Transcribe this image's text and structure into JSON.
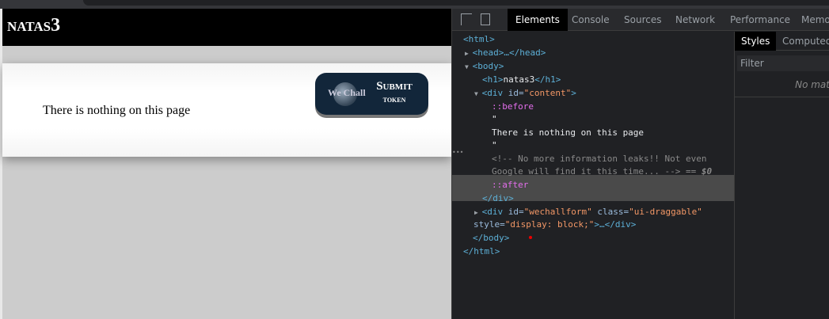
{
  "page": {
    "heading": "natas3",
    "content_text": "There is nothing on this page",
    "wechall": {
      "logo_text": "We Chall",
      "submit": "Submit",
      "token": "token"
    }
  },
  "devtools": {
    "tabs": [
      "Elements",
      "Console",
      "Sources",
      "Network",
      "Performance",
      "Memo"
    ],
    "active_tab": "Elements",
    "dom": {
      "html_open": "<html>",
      "head": "<head>…</head>",
      "body_open": "<body>",
      "h1_open": "<h1>",
      "h1_text": "natas3",
      "h1_close": "</h1>",
      "div_open_a": "<div ",
      "div_attr": "id=",
      "div_val": "\"content\"",
      "div_open_b": ">",
      "before": "::before",
      "quote": "\"",
      "text": "There is nothing on this page",
      "comment_1": "<!-- No more information leaks!! Not even",
      "comment_2": "Google will find it this time... -->",
      "eq": " == ",
      "dollar": "$0",
      "after": "::after",
      "div_close": "</div>",
      "wf_open": "<div ",
      "wf_id_attr": "id=",
      "wf_id_val": "\"wechallform\"",
      "wf_class_attr": " class=",
      "wf_class_val": "\"ui-draggable\"",
      "wf_style_attr": "style=",
      "wf_style_val": "\"display: block;\"",
      "wf_end": ">…</div>",
      "body_close": "</body>",
      "html_close": "</html>",
      "ellipsis": "•••"
    },
    "styles": {
      "tabs": [
        "Styles",
        "Computed"
      ],
      "filter_placeholder": "Filter",
      "no_match": "No mat"
    }
  }
}
